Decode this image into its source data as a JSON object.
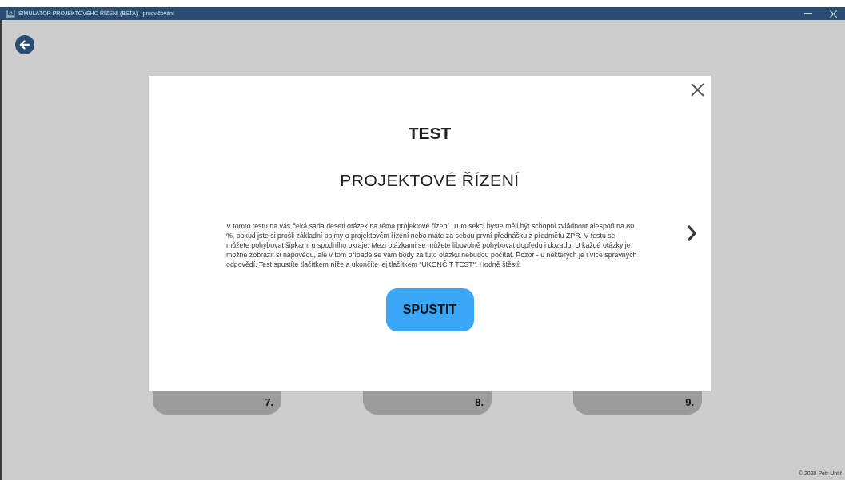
{
  "window": {
    "title": "SIMULÁTOR PROJEKTOVÉHO ŘÍZENÍ (BETA) - procvičování"
  },
  "cards": [
    {
      "number": "7."
    },
    {
      "number": "8."
    },
    {
      "number": "9."
    }
  ],
  "modal": {
    "title": "TEST",
    "subtitle": "PROJEKTOVÉ ŘÍZENÍ",
    "description": "V tomto testu na vás čeká sada deseti otázek na téma projektové řízení. Tuto sekci byste měli být schopni zvládnout alespoň na 80 %, pokud jste si prošli základní pojmy o projektovém řízení nebo máte za sebou první přednášku z předmětu ZPR. V testu se můžete pohybovat šipkami u spodního okraje. Mezi otázkami se můžete libovolně pohybovat dopředu i dozadu. U každé otázky je možné zobrazit si nápovědu, ale v tom případě se vám body za tuto otázku nebudou počítat. Pozor - u některých je i více správných odpovědí. Test spustíte tlačítkem níže a ukončíte jej tlačítkem \"UKONČIT TEST\". Hodně štěstí!",
    "button": "SPUSTIT"
  },
  "footer": "© 2020 Petr Uhlíř"
}
